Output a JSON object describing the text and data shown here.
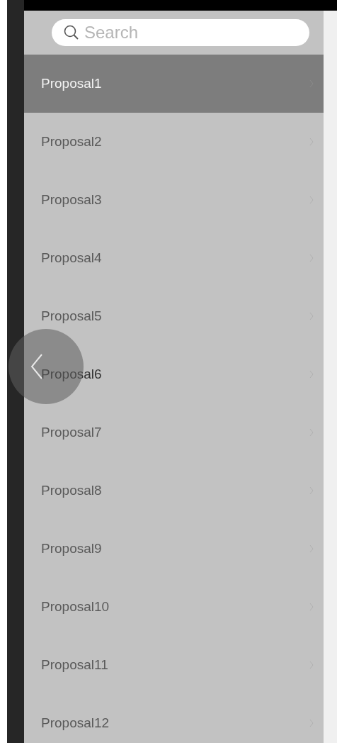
{
  "search": {
    "placeholder": "Search"
  },
  "items": [
    {
      "label": "Proposal1",
      "selected": true
    },
    {
      "label": "Proposal2",
      "selected": false
    },
    {
      "label": "Proposal3",
      "selected": false
    },
    {
      "label": "Proposal4",
      "selected": false
    },
    {
      "label": "Proposal5",
      "selected": false
    },
    {
      "label": "Proposal6",
      "selected": false
    },
    {
      "label": "Proposal7",
      "selected": false
    },
    {
      "label": "Proposal8",
      "selected": false
    },
    {
      "label": "Proposal9",
      "selected": false
    },
    {
      "label": "Proposal10",
      "selected": false
    },
    {
      "label": "Proposal11",
      "selected": false
    },
    {
      "label": "Proposal12",
      "selected": false
    }
  ]
}
